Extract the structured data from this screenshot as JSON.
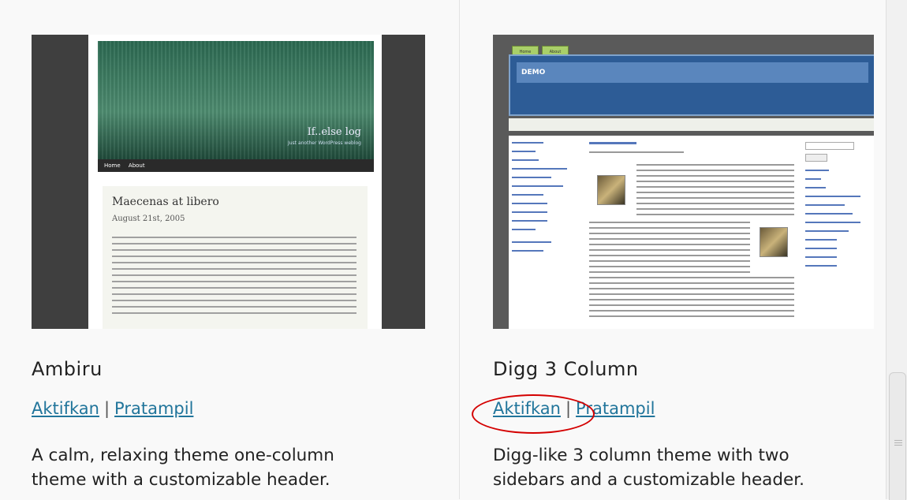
{
  "themes": [
    {
      "title": "Ambiru",
      "activate_label": "Aktifkan",
      "preview_label": "Pratampil",
      "separator": "|",
      "description_line1": "A calm, relaxing theme one-column",
      "description_line2": "theme with a customizable header.",
      "screenshot": {
        "blog_name": "If..else log",
        "tagline": "Just another WordPress weblog",
        "nav_home": "Home",
        "nav_about": "About",
        "post_title": "Maecenas at libero",
        "post_date": "August 21st, 2005"
      }
    },
    {
      "title": "Digg 3 Column",
      "activate_label": "Aktifkan",
      "preview_label": "Pratampil",
      "separator": "|",
      "description_line1": "Digg-like 3 column theme with two",
      "description_line2": "sidebars and a customizable header.",
      "screenshot": {
        "tab_home": "Home",
        "tab_about": "About",
        "header_text": "DEMO"
      }
    }
  ],
  "colors": {
    "link": "#21759b",
    "highlight_circle": "#d40000"
  }
}
